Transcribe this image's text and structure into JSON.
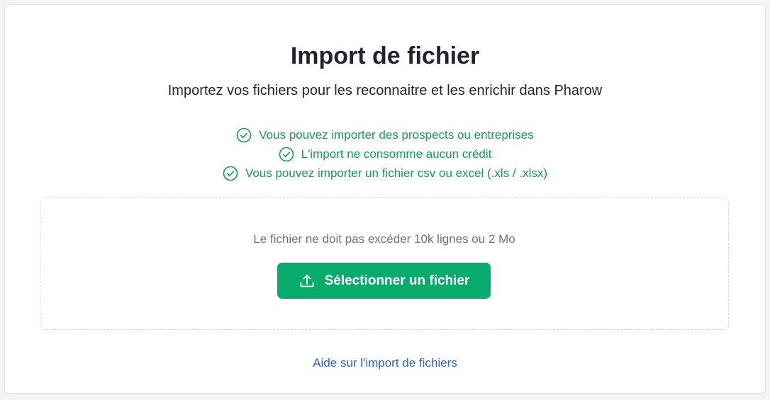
{
  "page": {
    "title": "Import de fichier",
    "subtitle": "Importez vos fichiers pour les reconnaitre et les enrichir dans Pharow"
  },
  "features": [
    {
      "icon": "check-circle-icon",
      "text": "Vous pouvez importer des prospects ou entreprises"
    },
    {
      "icon": "check-circle-icon",
      "text": "L'import ne consomme aucun crédit"
    },
    {
      "icon": "check-circle-icon",
      "text": "Vous pouvez importer un fichier csv ou excel (.xls / .xlsx)"
    }
  ],
  "dropzone": {
    "limit_text": "Le fichier ne doit pas excéder 10k lignes ou 2 Mo",
    "button_label": "Sélectionner un fichier",
    "button_icon": "upload-icon"
  },
  "help": {
    "link_text": "Aide sur l'import de fichiers"
  },
  "colors": {
    "accent_green": "#07ab6b",
    "feature_green": "#0f9d58",
    "link_blue": "#2563eb",
    "title_text": "#1f2430",
    "muted_text": "#6b7280"
  }
}
